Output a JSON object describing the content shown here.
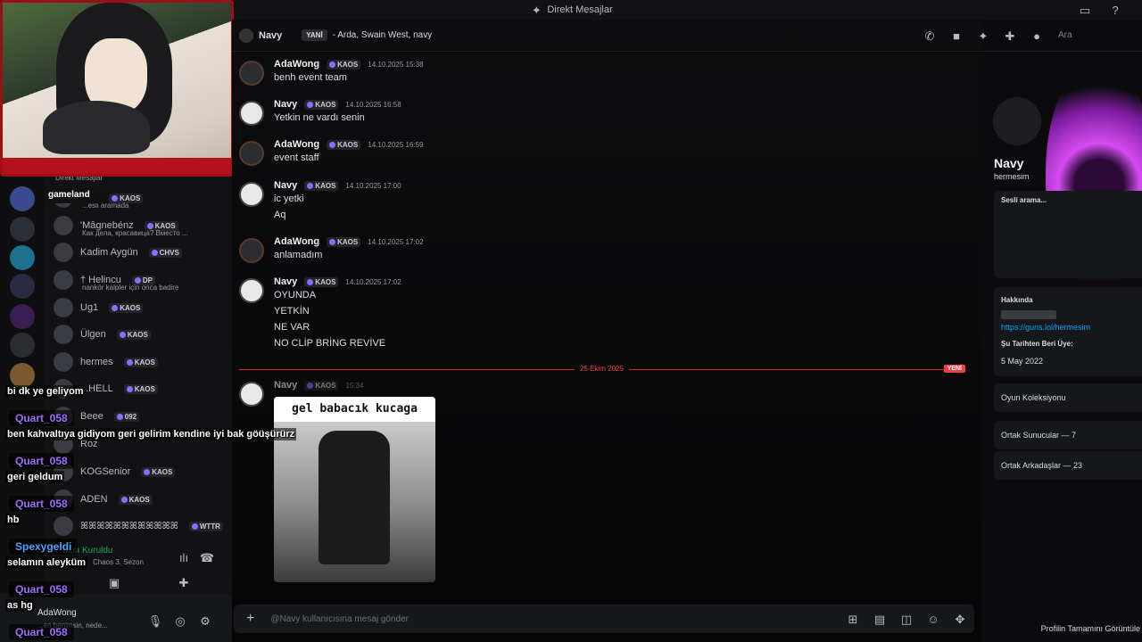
{
  "titlebar": {
    "title": "Direkt Mesajlar"
  },
  "header": {
    "name": "Navy",
    "new_badge": "YANİ",
    "members": "- Arda, Swain West, navy",
    "search_placeholder": "Ara"
  },
  "dm_section_label": "Direkt Mesajlar",
  "tooltip": "gameland",
  "dms": [
    {
      "name": "...vy",
      "tag": "KAOS",
      "sub": "...esli aramada"
    },
    {
      "name": "'Mâgnebénz",
      "tag": "KAOS",
      "sub": "Как дела, красавица? Вместо ..."
    },
    {
      "name": "Kadim Aygün",
      "tag": "CHVS",
      "sub": ""
    },
    {
      "name": "† Helincu",
      "tag": "DP",
      "sub": "nankör kalpler için onca badire"
    },
    {
      "name": "Ug1",
      "tag": "KAOS",
      "sub": ""
    },
    {
      "name": "Ülgen",
      "tag": "KAOS",
      "sub": ""
    },
    {
      "name": "hermes",
      "tag": "KAOS",
      "sub": ""
    },
    {
      "name": "...HELL",
      "tag": "KAOS",
      "sub": ""
    },
    {
      "name": "Beee",
      "tag": "092",
      "sub": ""
    },
    {
      "name": "Roz",
      "tag": "",
      "sub": ""
    },
    {
      "name": "KOGSenior",
      "tag": "KAOS",
      "sub": ""
    },
    {
      "name": "ADEN",
      "tag": "KAOS",
      "sub": ""
    },
    {
      "name": "ꕤꕤꕤꕤꕤꕤꕤꕤꕤꕤꕤꕤ",
      "tag": "WTTR",
      "sub": ""
    }
  ],
  "voice": {
    "status": "...ntısı Kuruldu",
    "channel": "Chaos 3. Sezon"
  },
  "user": {
    "name": "AdaWong",
    "status": "...en benimsin, nede..."
  },
  "messages": [
    {
      "author": "AdaWong",
      "tag": "KAOS",
      "time": "14.10.2025 15:38",
      "lines": [
        "benh event team"
      ]
    },
    {
      "author": "Navy",
      "tag": "KAOS",
      "time": "14.10.2025 16:58",
      "lines": [
        "Yetkin ne vardı senin"
      ]
    },
    {
      "author": "AdaWong",
      "tag": "KAOS",
      "time": "14.10.2025 16:59",
      "lines": [
        "event staff"
      ]
    },
    {
      "author": "Navy",
      "tag": "KAOS",
      "time": "14.10.2025 17:00",
      "lines": [
        "ic yetki",
        "Aq"
      ]
    },
    {
      "author": "AdaWong",
      "tag": "KAOS",
      "time": "14.10.2025 17:02",
      "lines": [
        "anlamadım"
      ]
    },
    {
      "author": "Navy",
      "tag": "KAOS",
      "time": "14.10.2025 17:02",
      "lines": [
        "OYUNDA",
        "YETKİN",
        "NE VAR",
        "NO CLİP BRİNG REVİVE"
      ]
    },
    {
      "author": "Navy",
      "tag": "KAOS",
      "time": "15:34",
      "lines": []
    }
  ],
  "divider": {
    "date": "25 Ekim 2025",
    "new": "YENİ"
  },
  "meme": {
    "caption": "gel babacık kucaga"
  },
  "composer": {
    "placeholder": "@Navy kullanıcısına mesaj gönder"
  },
  "profile": {
    "name": "Navy",
    "username": "hermesim",
    "voice_label": "Sesli arama...",
    "about_label": "Hakkında",
    "link": "https://guns.lol/hermesim",
    "member_since_label": "Şu Tarihten Beri Üye:",
    "member_since": "5 May 2022",
    "game_collection": "Oyun Koleksiyonu",
    "mutual_servers": "Ortak Sunucular — 7",
    "mutual_friends": "Ortak Arkadaşlar — 23",
    "full_profile": "Profilin Tamamını Görüntüle"
  },
  "stream_chat": [
    {
      "type": "msg",
      "text": "bi dk ye geliyom"
    },
    {
      "type": "user",
      "text": "Quart_058"
    },
    {
      "type": "msg",
      "text": "ben kahvaltıya gidiyom geri gelirim kendine iyi bak göüşürürz"
    },
    {
      "type": "user",
      "text": "Quart_058"
    },
    {
      "type": "msg",
      "text": "geri geldum"
    },
    {
      "type": "user",
      "text": "Quart_058"
    },
    {
      "type": "msg",
      "text": "hb"
    },
    {
      "type": "user",
      "text": "Spexygeldi"
    },
    {
      "type": "msg",
      "text": "selamın aleyküm"
    },
    {
      "type": "user",
      "text": "Quart_058"
    },
    {
      "type": "msg",
      "text": "as hg"
    },
    {
      "type": "user",
      "text": "Quart_058"
    }
  ],
  "colors": {
    "accent": "#5865f2",
    "alert": "#f23f42",
    "webcam_border": "#9b0f18",
    "user_purple": "#9f6cff",
    "user_blue": "#4aa3ff"
  }
}
